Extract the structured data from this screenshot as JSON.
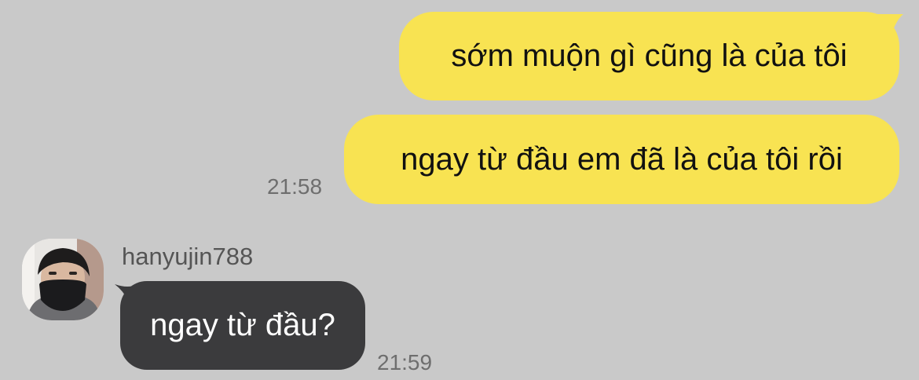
{
  "theme": {
    "background": "#c9c9c9",
    "outgoing_bubble": "#f8e352",
    "incoming_bubble": "#3b3b3d",
    "timestamp_color": "#6e6e6e"
  },
  "messages": [
    {
      "direction": "outgoing",
      "text": "sớm muộn gì cũng là của tôi"
    },
    {
      "direction": "outgoing",
      "text": "ngay từ đầu em đã là của tôi rồi",
      "time": "21:58"
    },
    {
      "direction": "incoming",
      "sender": "hanyujin788",
      "avatar_icon": "profile-photo",
      "text": "ngay từ đầu?",
      "time": "21:59"
    }
  ]
}
